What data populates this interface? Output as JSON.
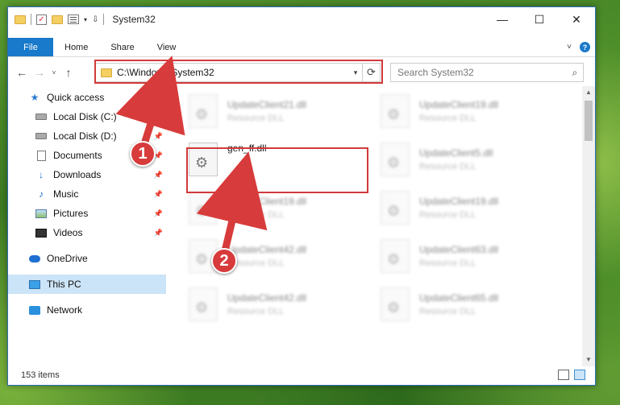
{
  "window": {
    "title": "System32",
    "controls": {
      "minimize": "—",
      "maximize": "☐",
      "close": "✕"
    }
  },
  "ribbon": {
    "tabs": [
      "File",
      "Home",
      "Share",
      "View"
    ],
    "help_label": "?"
  },
  "navbar": {
    "back": "←",
    "forward": "→",
    "recent": "˅",
    "up": "↑",
    "address": "C:\\Windows\\System32",
    "refresh": "⟳",
    "search_placeholder": "Search System32"
  },
  "sidebar": {
    "items": [
      {
        "label": "Quick access",
        "icon": "star-icon"
      },
      {
        "label": "Local Disk (C:)",
        "icon": "disk-icon"
      },
      {
        "label": "Local Disk (D:)",
        "icon": "disk-icon"
      },
      {
        "label": "Documents",
        "icon": "documents-icon"
      },
      {
        "label": "Downloads",
        "icon": "download-icon"
      },
      {
        "label": "Music",
        "icon": "music-icon"
      },
      {
        "label": "Pictures",
        "icon": "pictures-icon"
      },
      {
        "label": "Videos",
        "icon": "videos-icon"
      },
      {
        "label": "OneDrive",
        "icon": "cloud-icon"
      },
      {
        "label": "This PC",
        "icon": "computer-icon"
      },
      {
        "label": "Network",
        "icon": "network-icon"
      }
    ]
  },
  "files": [
    {
      "name": "UpdateClient21.dll",
      "type": "Resource DLL"
    },
    {
      "name": "UpdateClient19.dll",
      "type": "Resource DLL"
    },
    {
      "name": "gen_ff.dll",
      "type": ""
    },
    {
      "name": "UpdateClient5.dll",
      "type": "Resource DLL"
    },
    {
      "name": "UpdateClient19.dll",
      "type": "Resource DLL"
    },
    {
      "name": "UpdateClient19.dll",
      "type": "Resource DLL"
    },
    {
      "name": "UpdateClient42.dll",
      "type": "Resource DLL"
    },
    {
      "name": "UpdateClient63.dll",
      "type": "Resource DLL"
    },
    {
      "name": "UpdateClient42.dll",
      "type": "Resource DLL"
    },
    {
      "name": "UpdateClient65.dll",
      "type": "Resource DLL"
    }
  ],
  "status": {
    "item_count": "153 items"
  },
  "callouts": {
    "one": "1",
    "two": "2"
  },
  "colors": {
    "accent": "#1979ca",
    "highlight": "#d23a3a",
    "selected": "#cce4f7"
  }
}
